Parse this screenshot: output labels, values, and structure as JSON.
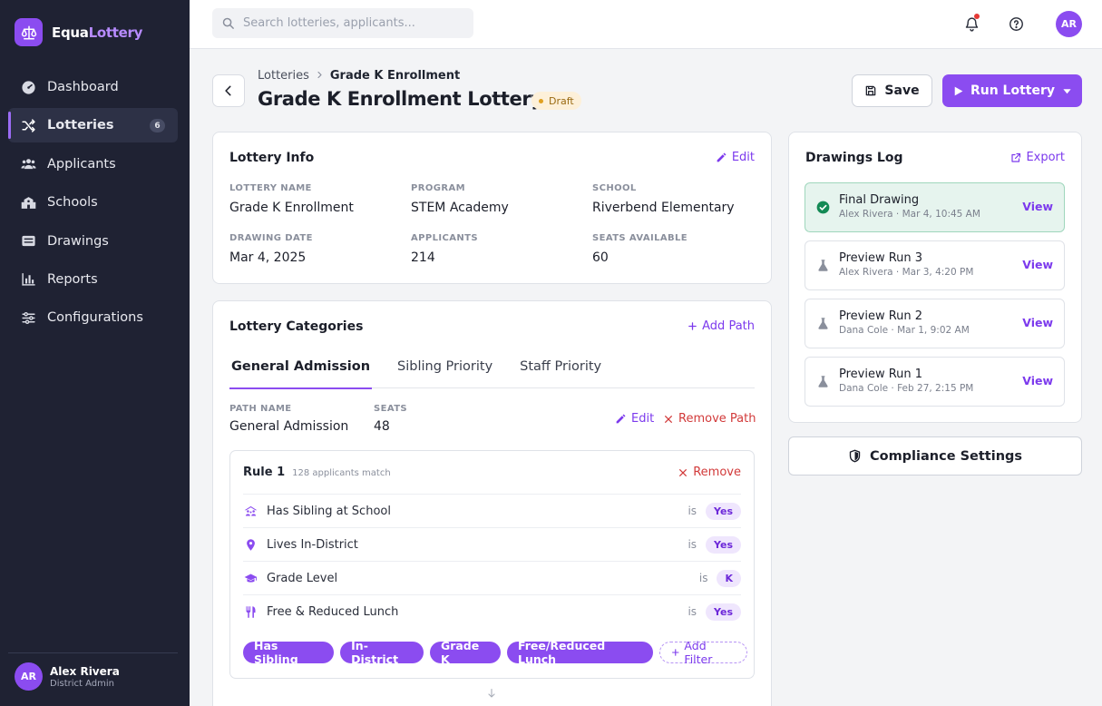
{
  "brand": {
    "name_part1": "Equa",
    "name_part2": "Lottery",
    "logo_icon": "scale-icon",
    "accent": "#8b4cf0"
  },
  "sidebar": {
    "items": [
      {
        "label": "Dashboard",
        "icon": "dashboard-icon"
      },
      {
        "label": "Lotteries",
        "icon": "shuffle-icon",
        "badge": "6",
        "active": true
      },
      {
        "label": "Applicants",
        "icon": "users-icon"
      },
      {
        "label": "Schools",
        "icon": "school-icon"
      },
      {
        "label": "Drawings",
        "icon": "drawings-icon"
      },
      {
        "label": "Reports",
        "icon": "chart-icon"
      },
      {
        "label": "Configurations",
        "icon": "sliders-icon"
      }
    ],
    "user": {
      "initials": "AR",
      "name": "Alex Rivera",
      "role": "District Admin"
    }
  },
  "topbar": {
    "search_placeholder": "Search lotteries, applicants...",
    "user_initials": "AR"
  },
  "header": {
    "breadcrumb_parent": "Lotteries",
    "breadcrumb_current": "Grade K Enrollment",
    "title": "Grade K Enrollment Lottery",
    "status": "Draft",
    "save_label": "Save",
    "run_label": "Run Lottery"
  },
  "lottery_info": {
    "title": "Lottery Info",
    "edit_label": "Edit",
    "fields": [
      {
        "label": "Lottery Name",
        "value": "Grade K Enrollment"
      },
      {
        "label": "Program",
        "value": "STEM Academy"
      },
      {
        "label": "School",
        "value": "Riverbend Elementary"
      },
      {
        "label": "Drawing Date",
        "value": "Mar 4, 2025"
      },
      {
        "label": "Applicants",
        "value": "214"
      },
      {
        "label": "Seats Available",
        "value": "60"
      }
    ]
  },
  "categories": {
    "title": "Lottery Categories",
    "add_label": "Add Path",
    "tabs": [
      "General Admission",
      "Sibling Priority",
      "Staff Priority"
    ],
    "path_name_label": "Path Name",
    "path_name_value": "General Admission",
    "seats_label": "Seats",
    "seats_value": "48",
    "edit_label": "Edit",
    "remove_path_label": "Remove Path",
    "rule": {
      "title": "Rule 1",
      "match": "128 applicants match",
      "remove_label": "Remove",
      "conditions": [
        {
          "name": "Has Sibling at School",
          "op": "is",
          "value": "Yes",
          "icon": "family-icon"
        },
        {
          "name": "Lives In-District",
          "op": "is",
          "value": "Yes",
          "icon": "location-pin-icon"
        },
        {
          "name": "Grade Level",
          "op": "is",
          "value": "K",
          "icon": "graduation-cap-icon"
        },
        {
          "name": "Free & Reduced Lunch",
          "op": "is",
          "value": "Yes",
          "icon": "utensils-icon"
        }
      ],
      "chips": [
        "Has Sibling",
        "In-District",
        "Grade K",
        "Free/Reduced Lunch"
      ],
      "add_filter_label": "Add Filter"
    }
  },
  "drawings_log": {
    "title": "Drawings Log",
    "export_label": "Export",
    "items": [
      {
        "title": "Final Drawing",
        "meta": "Alex Rivera · Mar 4, 10:45 AM",
        "action": "View",
        "status": "final"
      },
      {
        "title": "Preview Run 3",
        "meta": "Alex Rivera · Mar 3, 4:20 PM",
        "action": "View",
        "status": "preview"
      },
      {
        "title": "Preview Run 2",
        "meta": "Dana Cole · Mar 1, 9:02 AM",
        "action": "View",
        "status": "preview"
      },
      {
        "title": "Preview Run 1",
        "meta": "Dana Cole · Feb 27, 2:15 PM",
        "action": "View",
        "status": "preview"
      }
    ]
  },
  "compliance_label": "Compliance Settings"
}
